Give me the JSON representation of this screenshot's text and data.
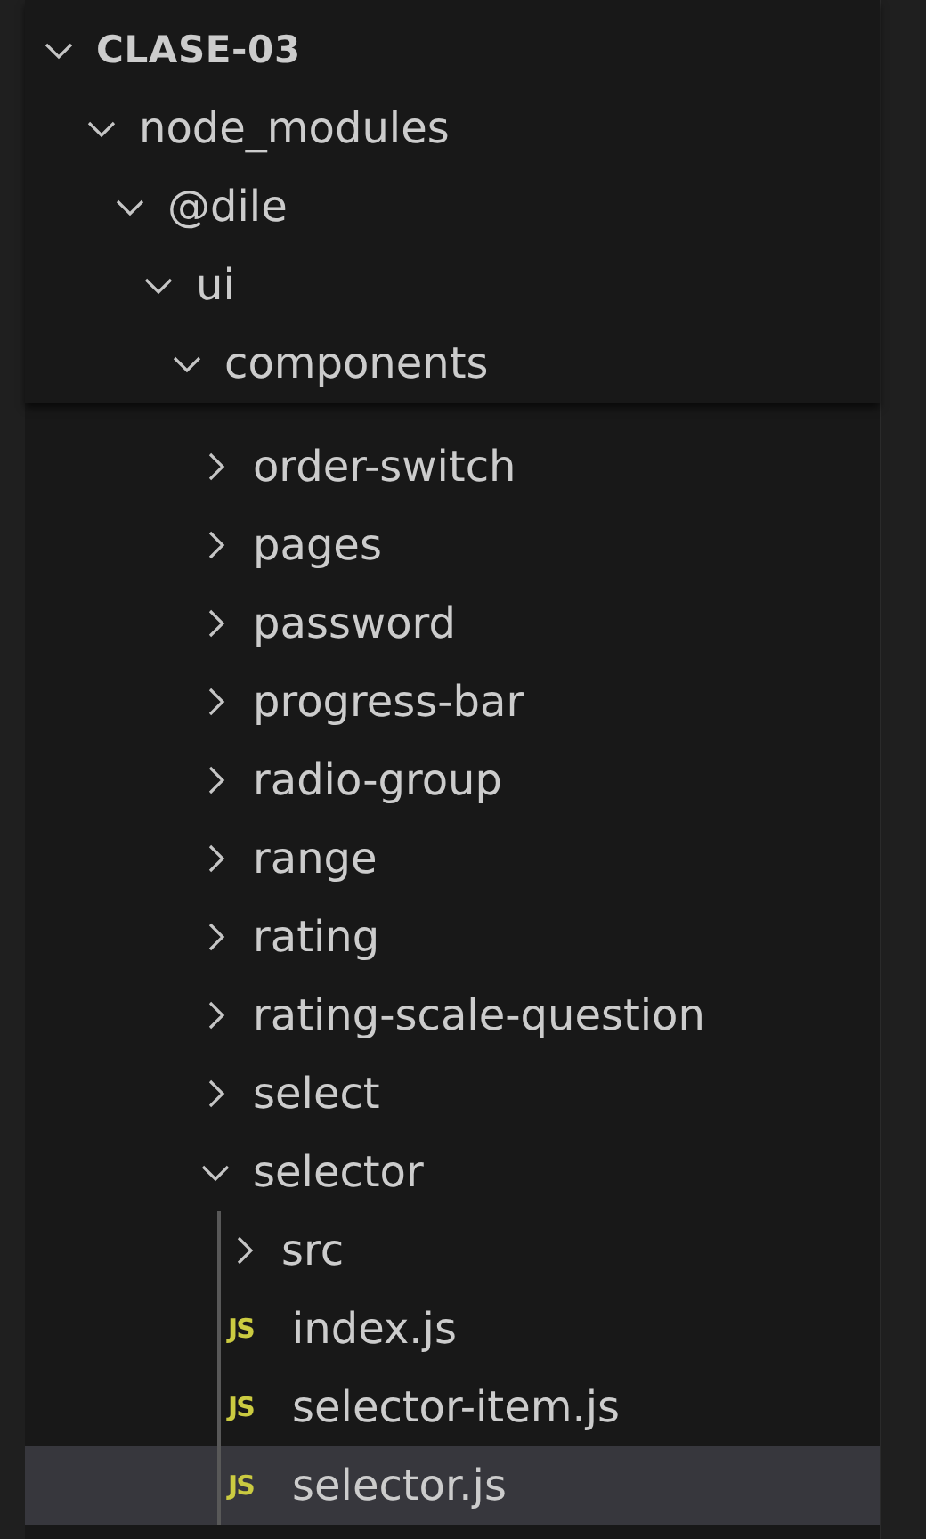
{
  "explorer": {
    "root": {
      "name": "CLASE-03",
      "kind": "folder",
      "expanded": true,
      "pinned": true,
      "selected": false,
      "children": [
        {
          "name": "node_modules",
          "kind": "folder",
          "expanded": true,
          "pinned": true,
          "selected": false,
          "children": [
            {
              "name": "@dile",
              "kind": "folder",
              "expanded": true,
              "pinned": true,
              "selected": false,
              "children": [
                {
                  "name": "ui",
                  "kind": "folder",
                  "expanded": true,
                  "pinned": true,
                  "selected": false,
                  "children": [
                    {
                      "name": "components",
                      "kind": "folder",
                      "expanded": true,
                      "pinned": true,
                      "selected": false,
                      "children": [
                        {
                          "name": "order-switch",
                          "kind": "folder",
                          "expanded": false,
                          "selected": false
                        },
                        {
                          "name": "pages",
                          "kind": "folder",
                          "expanded": false,
                          "selected": false
                        },
                        {
                          "name": "password",
                          "kind": "folder",
                          "expanded": false,
                          "selected": false
                        },
                        {
                          "name": "progress-bar",
                          "kind": "folder",
                          "expanded": false,
                          "selected": false
                        },
                        {
                          "name": "radio-group",
                          "kind": "folder",
                          "expanded": false,
                          "selected": false
                        },
                        {
                          "name": "range",
                          "kind": "folder",
                          "expanded": false,
                          "selected": false
                        },
                        {
                          "name": "rating",
                          "kind": "folder",
                          "expanded": false,
                          "selected": false
                        },
                        {
                          "name": "rating-scale-question",
                          "kind": "folder",
                          "expanded": false,
                          "selected": false
                        },
                        {
                          "name": "select",
                          "kind": "folder",
                          "expanded": false,
                          "selected": false
                        },
                        {
                          "name": "selector",
                          "kind": "folder",
                          "expanded": true,
                          "selected": false,
                          "children": [
                            {
                              "name": "src",
                              "kind": "folder",
                              "expanded": false,
                              "selected": false
                            },
                            {
                              "name": "index.js",
                              "kind": "file",
                              "badge": "JS",
                              "selected": false
                            },
                            {
                              "name": "selector-item.js",
                              "kind": "file",
                              "badge": "JS",
                              "selected": false
                            },
                            {
                              "name": "selector.js",
                              "kind": "file",
                              "badge": "JS",
                              "selected": true
                            }
                          ]
                        }
                      ]
                    }
                  ]
                }
              ]
            }
          ]
        }
      ]
    }
  }
}
